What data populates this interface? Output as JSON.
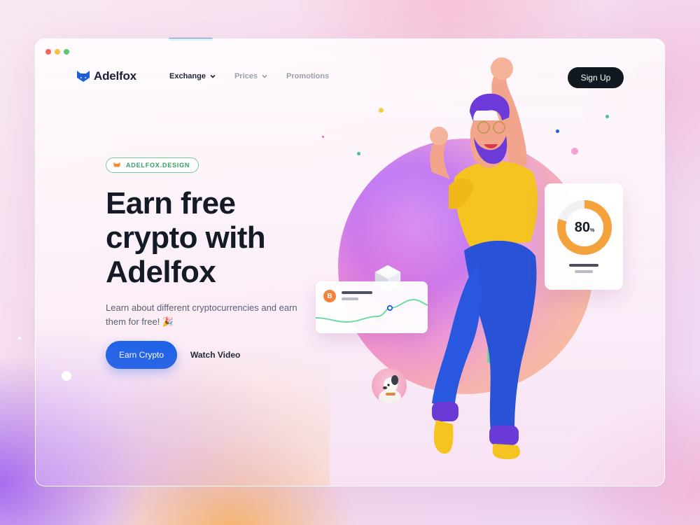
{
  "brand": {
    "name": "Adelfox",
    "color": "#1e63e6"
  },
  "nav": {
    "items": [
      {
        "label": "Exchange",
        "has_dropdown": true,
        "active": true
      },
      {
        "label": "Prices",
        "has_dropdown": true,
        "active": false
      },
      {
        "label": "Promotions",
        "has_dropdown": false,
        "active": false
      }
    ],
    "signup_label": "Sign Up"
  },
  "hero": {
    "badge": "ADELFOX.DESIGN",
    "headline_line1": "Earn free",
    "headline_line2": "crypto with",
    "headline_line3": "Adelfox",
    "subtext": "Learn about different cryptocurrencies and earn them for free! 🎉",
    "primary_cta": "Earn Crypto",
    "secondary_cta": "Watch Video"
  },
  "widgets": {
    "coin_symbol": "B",
    "coin_color": "#f4823a",
    "score_value": "80",
    "score_unit": "%",
    "score_percent": 80
  },
  "icons": {
    "logo": "fox-head-icon",
    "badge": "fox-emoji-icon",
    "dropdown": "chevron-down-icon",
    "coin": "bitcoin-icon"
  }
}
